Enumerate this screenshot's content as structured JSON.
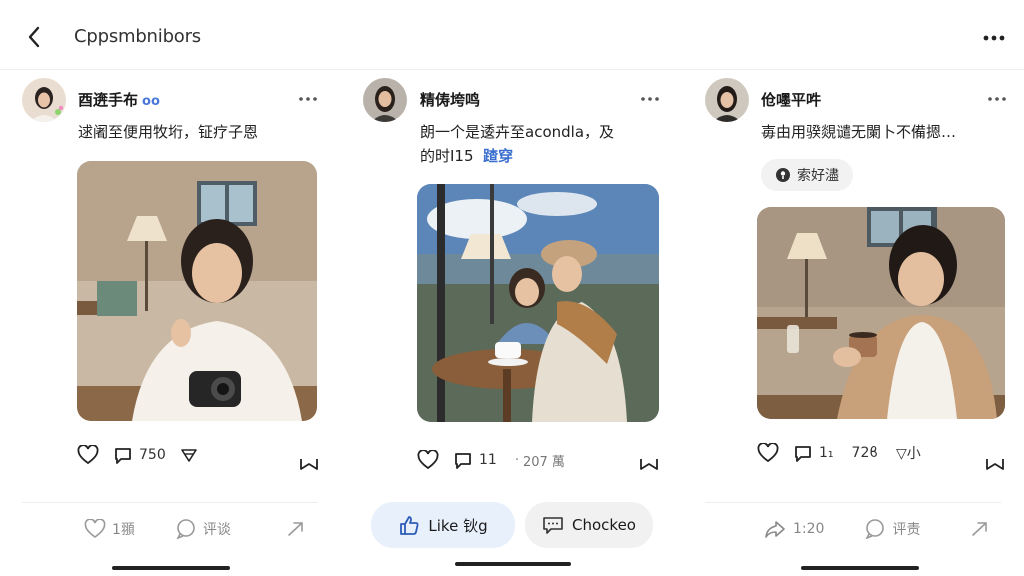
{
  "header": {
    "title": "Cppsmbnibors"
  },
  "posts": [
    {
      "username": "酉逩手布",
      "badge": "oo",
      "text_line1": "逑阇至便用牧垳，钲疗子恩",
      "likes": "750",
      "bottom_like": "1頨",
      "bottom_comment": "评谈"
    },
    {
      "username": "精俦垮鸣",
      "text_line1": "朗一个是逶卉至acondla，及",
      "text_line2": "的时I15",
      "text_highlight": "蹅穿",
      "comments": "11",
      "views": "207 萬",
      "like_button": "Like 钬g",
      "comment_button": "Chockeo"
    },
    {
      "username": "伧嚜平吽",
      "text_line1": "毐由用骙覢谴无闌卜不備摁…",
      "tag": "索好濜",
      "comments": "1₁",
      "likes": "72ϐ",
      "extra": "▽小",
      "bottom_share": "1:20",
      "bottom_comment": "评责"
    }
  ],
  "colors": {
    "accent": "#3a6fcf",
    "like_pill_bg": "#e8f0fb",
    "comment_pill_bg": "#f1f1f1"
  }
}
